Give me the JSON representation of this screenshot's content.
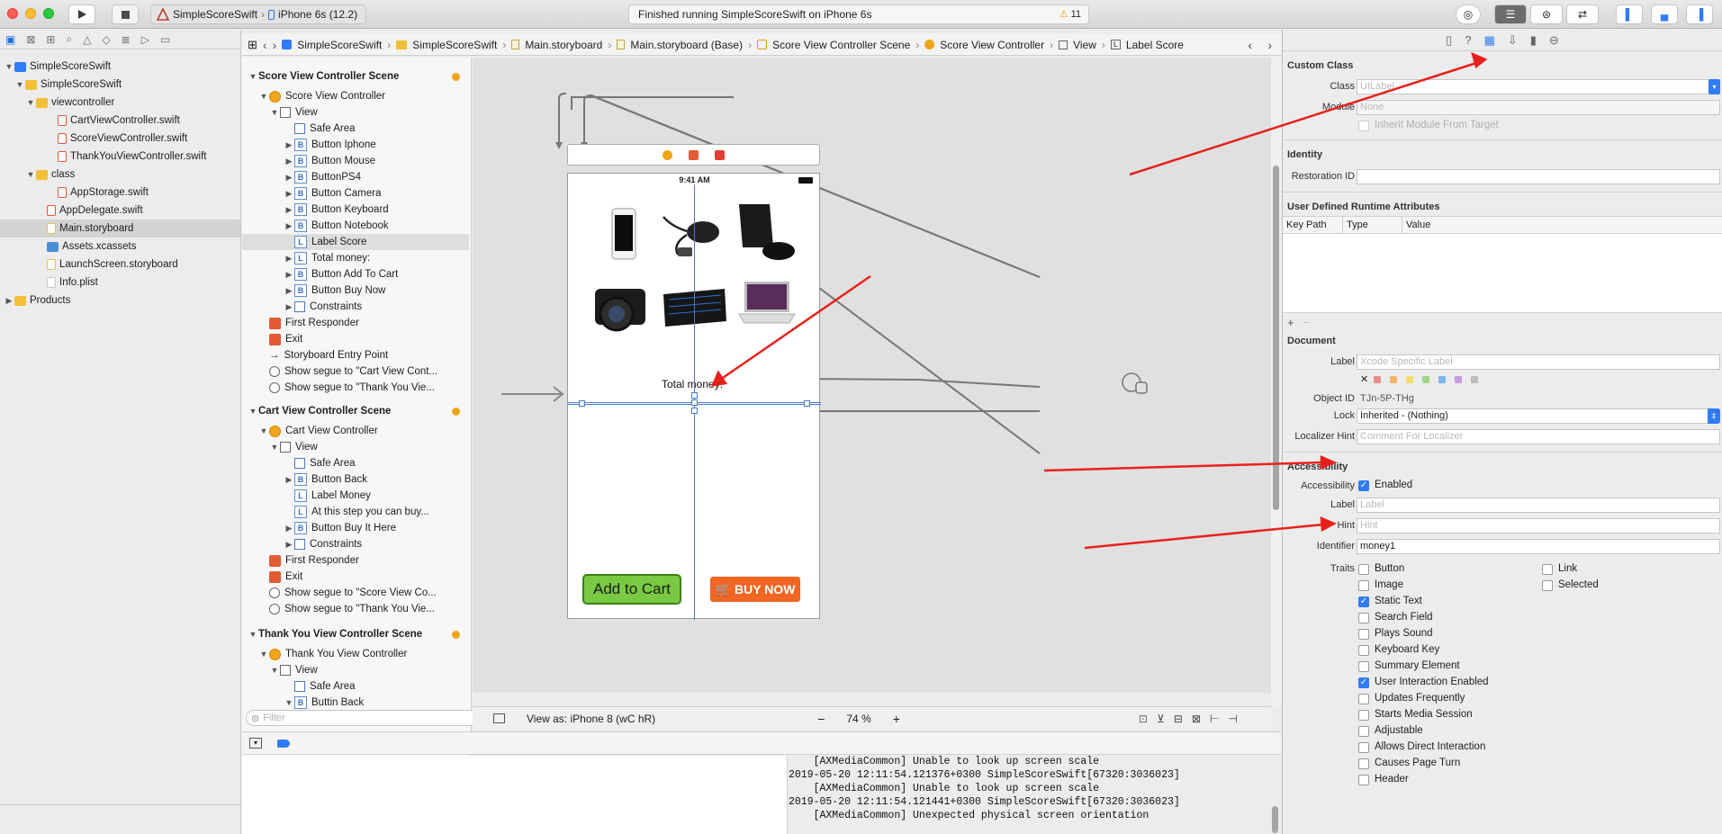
{
  "toolbar": {
    "scheme_target": "SimpleScoreSwift",
    "scheme_device": "iPhone 6s (12.2)",
    "status": "Finished running SimpleScoreSwift on iPhone 6s",
    "warnings": "11"
  },
  "navigator": {
    "items": [
      {
        "label": "SimpleScoreSwift",
        "icon": "project-icon"
      },
      {
        "label": "SimpleScoreSwift",
        "icon": "folder-icon"
      },
      {
        "label": "viewcontroller",
        "icon": "folder-icon"
      },
      {
        "label": "CartViewController.swift",
        "icon": "swift-file-icon"
      },
      {
        "label": "ScoreViewController.swift",
        "icon": "swift-file-icon"
      },
      {
        "label": "ThankYouViewController.swift",
        "icon": "swift-file-icon"
      },
      {
        "label": "class",
        "icon": "folder-icon"
      },
      {
        "label": "AppStorage.swift",
        "icon": "swift-file-icon"
      },
      {
        "label": "AppDelegate.swift",
        "icon": "swift-file-icon"
      },
      {
        "label": "Main.storyboard",
        "icon": "storyboard-icon"
      },
      {
        "label": "Assets.xcassets",
        "icon": "assets-icon"
      },
      {
        "label": "LaunchScreen.storyboard",
        "icon": "storyboard-icon"
      },
      {
        "label": "Info.plist",
        "icon": "plist-icon"
      },
      {
        "label": "Products",
        "icon": "folder-icon"
      }
    ],
    "filter_placeholder": "Filter"
  },
  "jumpbar": [
    "SimpleScoreSwift",
    "SimpleScoreSwift",
    "Main.storyboard",
    "Main.storyboard (Base)",
    "Score View Controller Scene",
    "Score View Controller",
    "View",
    "Label Score"
  ],
  "outline": {
    "rows": [
      {
        "label": "Score View Controller Scene",
        "kind": "scene"
      },
      {
        "label": "Score View Controller",
        "kind": "vc"
      },
      {
        "label": "View",
        "kind": "view"
      },
      {
        "label": "Safe Area",
        "kind": "area"
      },
      {
        "label": "Button Iphone",
        "kind": "B"
      },
      {
        "label": "Button Mouse",
        "kind": "B"
      },
      {
        "label": "ButtonPS4",
        "kind": "B"
      },
      {
        "label": "Button Camera",
        "kind": "B"
      },
      {
        "label": "Button Keyboard",
        "kind": "B"
      },
      {
        "label": "Button Notebook",
        "kind": "B"
      },
      {
        "label": "Label Score",
        "kind": "L"
      },
      {
        "label": "Total money:",
        "kind": "L"
      },
      {
        "label": "Button Add To Cart",
        "kind": "B"
      },
      {
        "label": "Button Buy Now",
        "kind": "B"
      },
      {
        "label": "Constraints",
        "kind": "area"
      },
      {
        "label": "First Responder",
        "kind": "red"
      },
      {
        "label": "Exit",
        "kind": "red"
      },
      {
        "label": "Storyboard Entry Point",
        "kind": "arrow"
      },
      {
        "label": "Show segue to \"Cart View Cont...",
        "kind": "seg"
      },
      {
        "label": "Show segue to \"Thank You Vie...",
        "kind": "seg"
      },
      {
        "label": "Cart View Controller Scene",
        "kind": "scene"
      },
      {
        "label": "Cart View Controller",
        "kind": "vc"
      },
      {
        "label": "View",
        "kind": "view"
      },
      {
        "label": "Safe Area",
        "kind": "area"
      },
      {
        "label": "Button Back",
        "kind": "B"
      },
      {
        "label": "Label Money",
        "kind": "L"
      },
      {
        "label": "At this step you can buy...",
        "kind": "L"
      },
      {
        "label": "Button Buy It Here",
        "kind": "B"
      },
      {
        "label": "Constraints",
        "kind": "area"
      },
      {
        "label": "First Responder",
        "kind": "red"
      },
      {
        "label": "Exit",
        "kind": "red"
      },
      {
        "label": "Show segue to \"Score View Co...",
        "kind": "seg"
      },
      {
        "label": "Show segue to \"Thank You Vie...",
        "kind": "seg"
      },
      {
        "label": "Thank You View Controller Scene",
        "kind": "scene"
      },
      {
        "label": "Thank You View Controller",
        "kind": "vc"
      },
      {
        "label": "View",
        "kind": "view"
      },
      {
        "label": "Safe Area",
        "kind": "area"
      },
      {
        "label": "Buttin Back",
        "kind": "B"
      }
    ]
  },
  "canvas": {
    "phone_time": "9:41 AM",
    "total_money_label": "Total money:",
    "add_to_cart": "Add to Cart",
    "buy_now": "BUY NOW",
    "view_as": "View as: iPhone 8 (wC hR)",
    "zoom": "74 %"
  },
  "inspector": {
    "custom_class": {
      "title": "Custom Class",
      "class_label": "Class",
      "class_value": "UILabel",
      "module_label": "Module",
      "module_value": "None",
      "inherit": "Inherit Module From Target"
    },
    "identity": {
      "title": "Identity",
      "restoration_label": "Restoration ID",
      "restoration_value": ""
    },
    "runtime": {
      "title": "User Defined Runtime Attributes",
      "col_keypath": "Key Path",
      "col_type": "Type",
      "col_value": "Value"
    },
    "document": {
      "title": "Document",
      "label_label": "Label",
      "label_placeholder": "Xcode Specific Label",
      "objectid_label": "Object ID",
      "objectid_value": "TJn-5P-THg",
      "lock_label": "Lock",
      "lock_value": "Inherited - (Nothing)",
      "localizer_label": "Localizer Hint",
      "localizer_placeholder": "Comment For Localizer"
    },
    "accessibility": {
      "title": "Accessibility",
      "accessibility_label": "Accessibility",
      "enabled": "Enabled",
      "label_label": "Label",
      "label_placeholder": "Label",
      "hint_label": "Hint",
      "hint_placeholder": "Hint",
      "identifier_label": "Identifier",
      "identifier_value": "money1",
      "traits_label": "Traits",
      "traits_left": [
        {
          "label": "Button",
          "checked": false
        },
        {
          "label": "Image",
          "checked": false
        },
        {
          "label": "Static Text",
          "checked": true
        },
        {
          "label": "Search Field",
          "checked": false
        },
        {
          "label": "Plays Sound",
          "checked": false
        },
        {
          "label": "Keyboard Key",
          "checked": false
        },
        {
          "label": "Summary Element",
          "checked": false
        },
        {
          "label": "User Interaction Enabled",
          "checked": true
        },
        {
          "label": "Updates Frequently",
          "checked": false
        },
        {
          "label": "Starts Media Session",
          "checked": false
        },
        {
          "label": "Adjustable",
          "checked": false
        },
        {
          "label": "Allows Direct Interaction",
          "checked": false
        },
        {
          "label": "Causes Page Turn",
          "checked": false
        },
        {
          "label": "Header",
          "checked": false
        }
      ],
      "traits_right": [
        {
          "label": "Link",
          "checked": false
        },
        {
          "label": "Selected",
          "checked": false
        }
      ]
    }
  },
  "console": {
    "lines": [
      "    [AXMediaCommon] Unable to look up screen scale",
      "2019-05-20 12:11:54.121376+0300 SimpleScoreSwift[67320:3036023]",
      "    [AXMediaCommon] Unable to look up screen scale",
      "2019-05-20 12:11:54.121441+0300 SimpleScoreSwift[67320:3036023]",
      "    [AXMediaCommon] Unexpected physical screen orientation"
    ]
  },
  "colors": {
    "accent": "#2f7cf6",
    "annotation_arrow": "#e8211c",
    "add_to_cart": "#7ac943",
    "buy_now": "#f26522"
  }
}
